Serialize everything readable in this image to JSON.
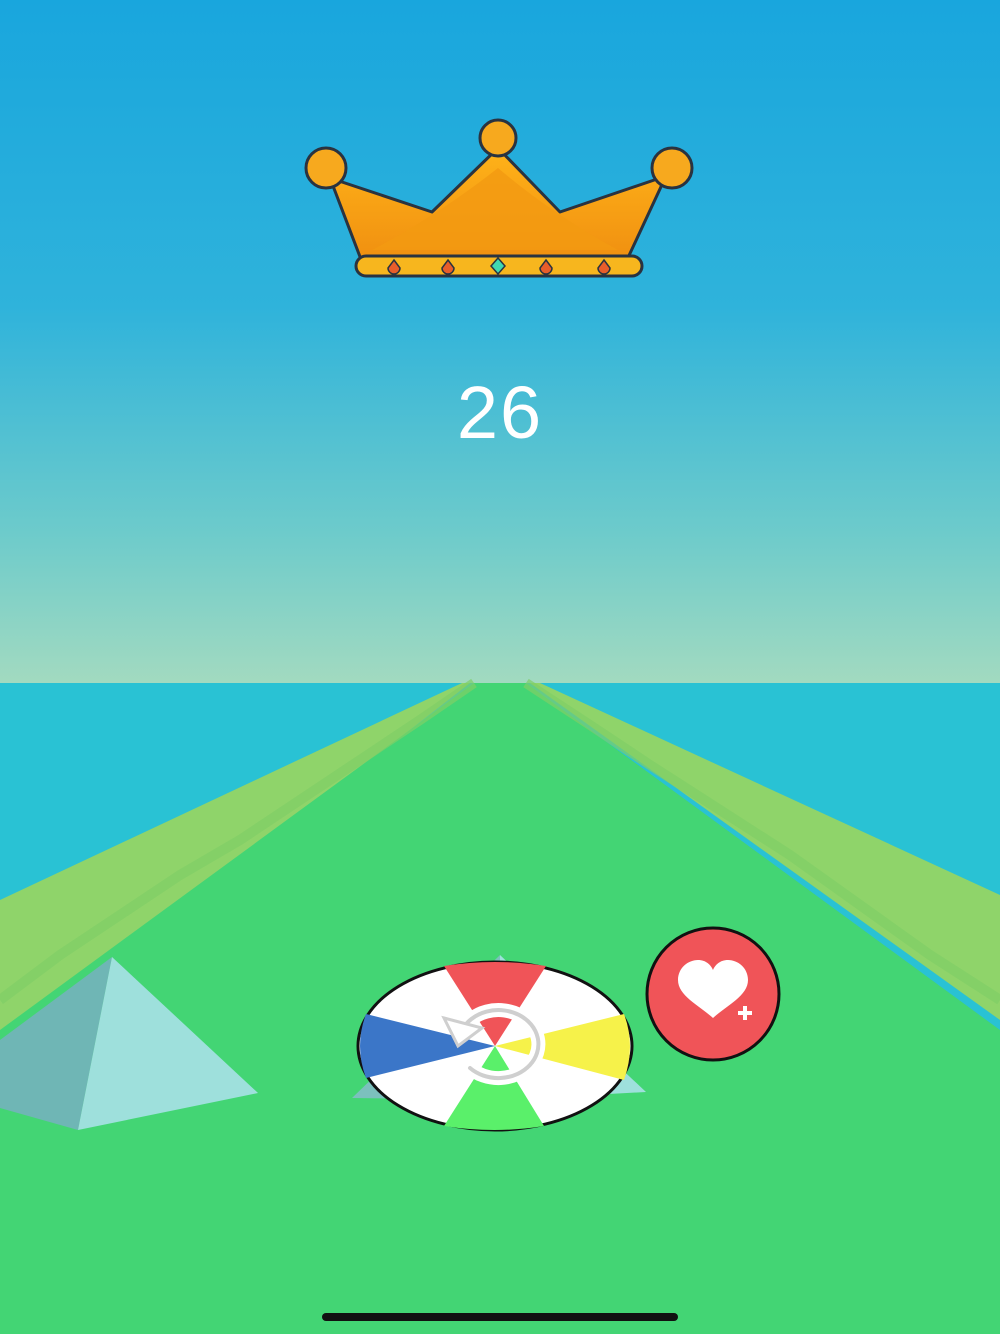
{
  "hud": {
    "score": "26",
    "crown_icon": "crown-icon"
  },
  "controls": {
    "color_wheel": {
      "segment_colors": [
        "#f05458",
        "#f6f24a",
        "#5af06a",
        "#3b76c8"
      ],
      "center_icon": "rotate-icon"
    },
    "extra_life_button": {
      "icon": "heart-plus-icon",
      "color": "#f05458"
    }
  },
  "colors": {
    "sky_top": "#1ba6dd",
    "sky_bottom": "#9cd9c0",
    "sea": "#29c2d4",
    "track": "#43d574",
    "track_edge": "#8fd46a",
    "pyramid": "#9ee0dc"
  }
}
